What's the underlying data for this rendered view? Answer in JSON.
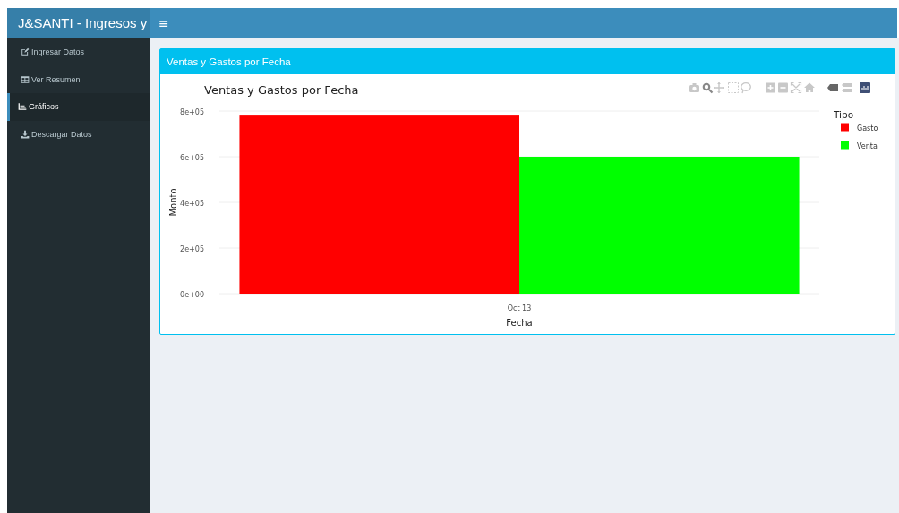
{
  "header": {
    "title": "J&SANTI - Ingresos y",
    "menu_glyph": "≡"
  },
  "sidebar": {
    "items": [
      {
        "label": "Ingresar Datos",
        "selected": false
      },
      {
        "label": "Ver Resumen",
        "selected": false
      },
      {
        "label": "Gráficos",
        "selected": true
      },
      {
        "label": "Descargar Datos",
        "selected": false
      }
    ]
  },
  "box": {
    "title": "Ventas y Gastos por Fecha",
    "chart_data": {
      "type": "bar",
      "title": "Ventas y Gastos por Fecha",
      "xlabel": "Fecha",
      "ylabel": "Monto",
      "categories": [
        "Oct 13"
      ],
      "series": [
        {
          "name": "Gasto",
          "color": "#ff0000",
          "values": [
            780000
          ]
        },
        {
          "name": "Venta",
          "color": "#00ff00",
          "values": [
            600000
          ]
        }
      ],
      "ylim": [
        0,
        800000
      ],
      "yticks": [
        {
          "value": 0,
          "label": "0e+00"
        },
        {
          "value": 200000,
          "label": "2e+05"
        },
        {
          "value": 400000,
          "label": "4e+05"
        },
        {
          "value": 600000,
          "label": "6e+05"
        },
        {
          "value": 800000,
          "label": "8e+05"
        }
      ],
      "grid": true,
      "legend": {
        "title": "Tipo"
      }
    }
  }
}
